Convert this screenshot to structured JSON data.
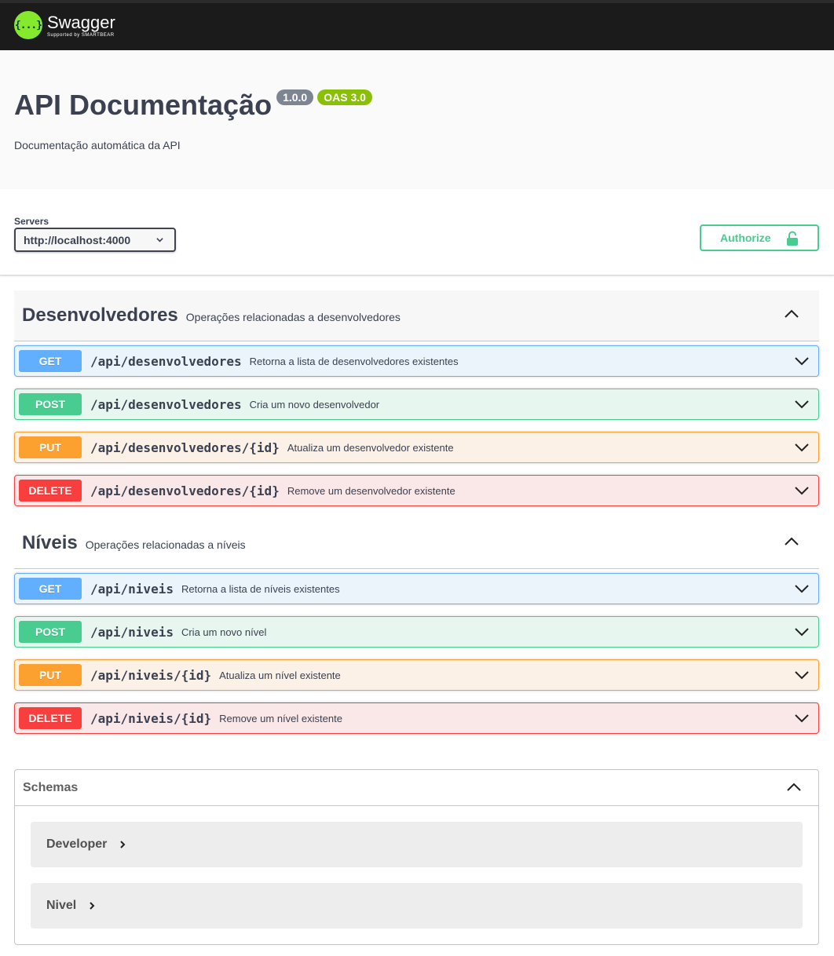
{
  "topbar": {
    "logo_glyph": "{...}",
    "brand": "Swagger",
    "brand_sub": "Supported by SMARTBEAR",
    "brand_color": "#85ea2d"
  },
  "info": {
    "title": "API Documentação",
    "version": "1.0.0",
    "oas": "OAS 3.0",
    "description": "Documentação automática da API"
  },
  "servers": {
    "label": "Servers",
    "selected": "http://localhost:4000",
    "authorize_label": "Authorize"
  },
  "tags": [
    {
      "name": "Desenvolvedores",
      "description": "Operações relacionadas a desenvolvedores",
      "operations": [
        {
          "method": "GET",
          "path": "/api/desenvolvedores",
          "summary": "Retorna a lista de desenvolvedores existentes"
        },
        {
          "method": "POST",
          "path": "/api/desenvolvedores",
          "summary": "Cria um novo desenvolvedor"
        },
        {
          "method": "PUT",
          "path": "/api/desenvolvedores/{id}",
          "summary": "Atualiza um desenvolvedor existente"
        },
        {
          "method": "DELETE",
          "path": "/api/desenvolvedores/{id}",
          "summary": "Remove um desenvolvedor existente"
        }
      ]
    },
    {
      "name": "Níveis",
      "description": "Operações relacionadas a níveis",
      "operations": [
        {
          "method": "GET",
          "path": "/api/niveis",
          "summary": "Retorna a lista de níveis existentes"
        },
        {
          "method": "POST",
          "path": "/api/niveis",
          "summary": "Cria um novo nível"
        },
        {
          "method": "PUT",
          "path": "/api/niveis/{id}",
          "summary": "Atualiza um nível existente"
        },
        {
          "method": "DELETE",
          "path": "/api/niveis/{id}",
          "summary": "Remove um nível existente"
        }
      ]
    }
  ],
  "schemas": {
    "title": "Schemas",
    "models": [
      "Developer",
      "Nivel"
    ]
  },
  "colors": {
    "get": "#61affe",
    "post": "#49cc90",
    "put": "#fca130",
    "delete": "#f93e3e"
  }
}
